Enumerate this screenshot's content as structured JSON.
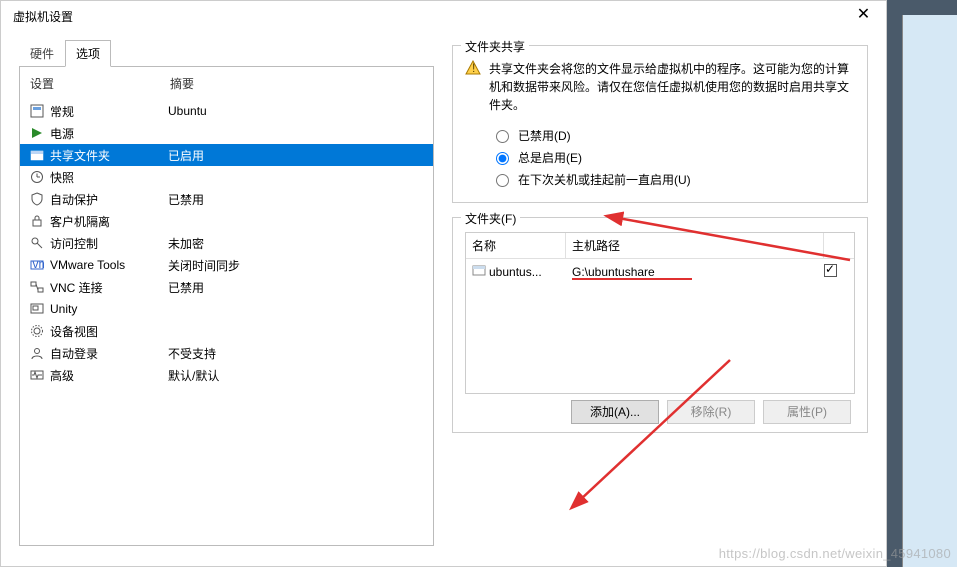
{
  "window": {
    "title": "虚拟机设置"
  },
  "tabs": {
    "hardware": "硬件",
    "options": "选项"
  },
  "left": {
    "header_setting": "设置",
    "header_summary": "摘要",
    "rows": [
      {
        "label": "常规",
        "summary": "Ubuntu"
      },
      {
        "label": "电源",
        "summary": ""
      },
      {
        "label": "共享文件夹",
        "summary": "已启用"
      },
      {
        "label": "快照",
        "summary": ""
      },
      {
        "label": "自动保护",
        "summary": "已禁用"
      },
      {
        "label": "客户机隔离",
        "summary": ""
      },
      {
        "label": "访问控制",
        "summary": "未加密"
      },
      {
        "label": "VMware Tools",
        "summary": "关闭时间同步"
      },
      {
        "label": "VNC 连接",
        "summary": "已禁用"
      },
      {
        "label": "Unity",
        "summary": ""
      },
      {
        "label": "设备视图",
        "summary": ""
      },
      {
        "label": "自动登录",
        "summary": "不受支持"
      },
      {
        "label": "高级",
        "summary": "默认/默认"
      }
    ]
  },
  "share_group": {
    "title": "文件夹共享",
    "warning": "共享文件夹会将您的文件显示给虚拟机中的程序。这可能为您的计算机和数据带来风险。请仅在您信任虚拟机使用您的数据时启用共享文件夹。",
    "radio_disabled": "已禁用(D)",
    "radio_always": "总是启用(E)",
    "radio_until": "在下次关机或挂起前一直启用(U)"
  },
  "folders_group": {
    "title": "文件夹(F)",
    "col_name": "名称",
    "col_path": "主机路径",
    "row_name": "ubuntus...",
    "row_path": "G:\\ubuntushare",
    "btn_add": "添加(A)...",
    "btn_remove": "移除(R)",
    "btn_props": "属性(P)"
  },
  "watermark": "https://blog.csdn.net/weixin_45941080"
}
